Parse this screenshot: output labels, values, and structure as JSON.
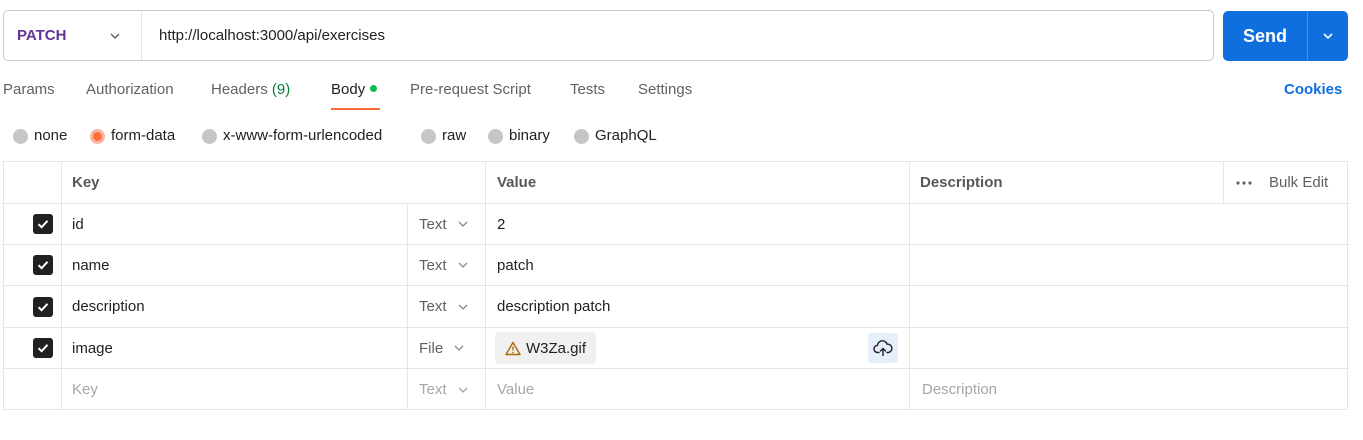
{
  "request": {
    "method": "PATCH",
    "url": "http://localhost:3000/api/exercises",
    "send_label": "Send"
  },
  "tabs": {
    "params": "Params",
    "authorization": "Authorization",
    "headers": "Headers",
    "headers_count": "(9)",
    "body": "Body",
    "prerequest": "Pre-request Script",
    "tests": "Tests",
    "settings": "Settings",
    "active": "Body"
  },
  "cookies_label": "Cookies",
  "body_types": {
    "none": "none",
    "form_data": "form-data",
    "urlencoded": "x-www-form-urlencoded",
    "raw": "raw",
    "binary": "binary",
    "graphql": "GraphQL",
    "selected": "form-data"
  },
  "table": {
    "headers": {
      "key": "Key",
      "value": "Value",
      "description": "Description",
      "bulk_edit": "Bulk Edit"
    },
    "rows": [
      {
        "checked": true,
        "key": "id",
        "type": "Text",
        "value": "2",
        "description": ""
      },
      {
        "checked": true,
        "key": "name",
        "type": "Text",
        "value": "patch",
        "description": ""
      },
      {
        "checked": true,
        "key": "description",
        "type": "Text",
        "value": "description patch",
        "description": ""
      },
      {
        "checked": true,
        "key": "image",
        "type": "File",
        "value": "W3Za.gif",
        "description": ""
      }
    ],
    "placeholder": {
      "key": "Key",
      "type": "Text",
      "value": "Value",
      "description": "Description"
    }
  },
  "colors": {
    "method": "#623497",
    "send": "#0f6fde",
    "accent": "#ff6c37",
    "success_dot": "#0cbb52"
  }
}
